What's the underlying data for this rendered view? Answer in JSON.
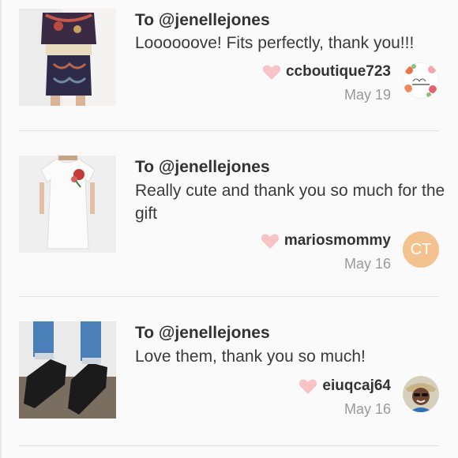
{
  "reviews": [
    {
      "to": "To @jenellejones",
      "message": "Loooooove! Fits perfectly, thank you!!!",
      "username": "ccboutique723",
      "date": "May 19",
      "avatar": {
        "type": "logo",
        "lines": [
          "ccboutique723",
          "BOUTIQUE"
        ]
      }
    },
    {
      "to": "To @jenellejones",
      "message": "Really cute and thank you so much for the gift",
      "username": "mariosmommy",
      "date": "May 16",
      "avatar": {
        "type": "initials",
        "initials": "CT",
        "color": "#f3c28e"
      }
    },
    {
      "to": "To @jenellejones",
      "message": "Love them, thank you so much!",
      "username": "eiuqcaj64",
      "date": "May 16",
      "avatar": {
        "type": "photo"
      }
    }
  ],
  "colors": {
    "heart": "#f7c3c6",
    "divider": "#e3e1e3",
    "date": "#999999"
  }
}
